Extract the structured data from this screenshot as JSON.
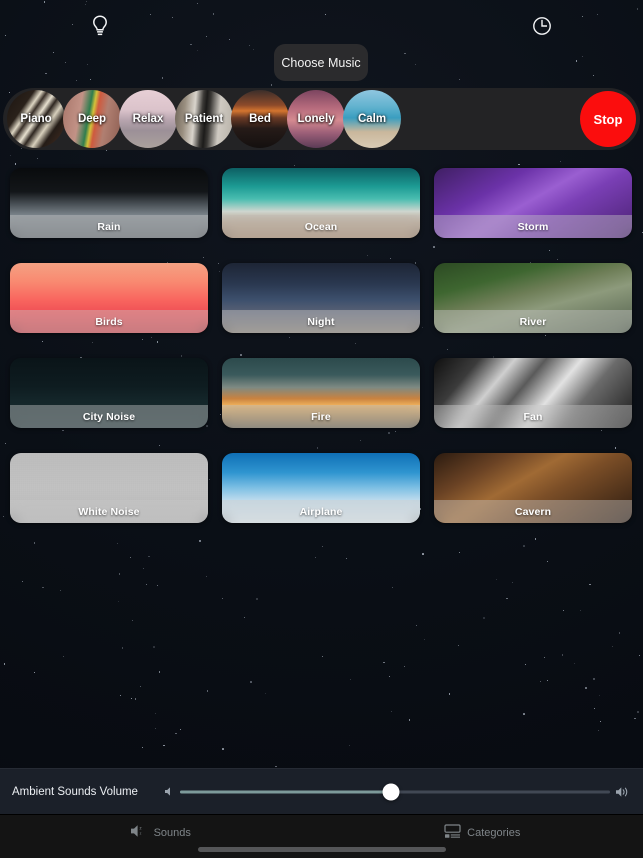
{
  "header": {
    "lightbulb_icon": "lightbulb-icon",
    "timer_icon": "clock-icon",
    "choose_music_label": "Choose Music"
  },
  "music_bar": {
    "chips": [
      {
        "label": "Piano",
        "art": "piano-keys"
      },
      {
        "label": "Deep",
        "art": "lips-rainbow"
      },
      {
        "label": "Relax",
        "art": "woman-sitting-shore"
      },
      {
        "label": "Patient",
        "art": "window-clock"
      },
      {
        "label": "Bed",
        "art": "sunset-window"
      },
      {
        "label": "Lonely",
        "art": "pink-sky-moon"
      },
      {
        "label": "Calm",
        "art": "stacked-stones-sea"
      }
    ],
    "stop_label": "Stop",
    "stop_color": "#fb0d0d"
  },
  "sounds": [
    {
      "label": "Rain",
      "art": "rain-splash"
    },
    {
      "label": "Ocean",
      "art": "ocean-shore"
    },
    {
      "label": "Storm",
      "art": "lightning-purple"
    },
    {
      "label": "Birds",
      "art": "birds-sunset"
    },
    {
      "label": "Night",
      "art": "star-trails"
    },
    {
      "label": "River",
      "art": "waterfall-forest"
    },
    {
      "label": "City Noise",
      "art": "city-skyline-moon"
    },
    {
      "label": "Fire",
      "art": "campfire-dusk"
    },
    {
      "label": "Fan",
      "art": "fan-blades-bw"
    },
    {
      "label": "White Noise",
      "art": "static-noise"
    },
    {
      "label": "Airplane",
      "art": "airplane-wing-sky"
    },
    {
      "label": "Cavern",
      "art": "cave-rocks"
    }
  ],
  "volume": {
    "label": "Ambient Sounds Volume",
    "value_percent": 49,
    "min_icon": "speaker-low-icon",
    "max_icon": "speaker-high-icon"
  },
  "tabbar": {
    "tabs": [
      {
        "label": "Sounds",
        "icon": "speaker-sleep-icon",
        "selected": false
      },
      {
        "label": "Categories",
        "icon": "categories-list-icon",
        "selected": false
      }
    ]
  }
}
